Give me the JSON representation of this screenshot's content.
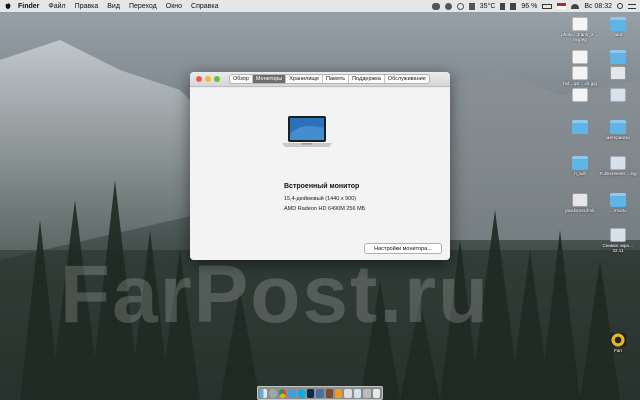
{
  "menubar": {
    "app": "Finder",
    "menus": [
      "Файл",
      "Правка",
      "Вид",
      "Переход",
      "Окно",
      "Справка"
    ],
    "temperature": "35°C",
    "battery": "96 %",
    "clock": "Вс 08:32"
  },
  "window": {
    "tabs": [
      "Обзор",
      "Мониторы",
      "Хранилище",
      "Память",
      "Поддержка",
      "Обслуживание"
    ],
    "active_tab": "Мониторы",
    "display_name": "Встроенный монитор",
    "resolution": "15,4-дюймовый (1440 x 900)",
    "graphics": "AMD Radeon HD 6490M 256 МБ",
    "settings_button": "Настройки монитора..."
  },
  "desktop": {
    "watermark": "FarPost.ru",
    "icons": [
      {
        "label": "photo…3 ans_3 …m.jpeg",
        "kind": "doc"
      },
      {
        "label": "card",
        "kind": "folder"
      },
      {
        "label": "",
        "kind": "doc"
      },
      {
        "label": "",
        "kind": "folder"
      },
      {
        "label": "hid…qsl …ck.jpg",
        "kind": "doc"
      },
      {
        "label": "",
        "kind": "docdark"
      },
      {
        "label": "",
        "kind": "doc"
      },
      {
        "label": "",
        "kind": "shot"
      },
      {
        "label": "",
        "kind": "folder"
      },
      {
        "label": "материалы",
        "kind": "folder"
      },
      {
        "label": "h_wiif",
        "kind": "folder"
      },
      {
        "label": "FullScreenM …ing",
        "kind": "shot"
      },
      {
        "label": "javaforest.ifmb",
        "kind": "docdark"
      },
      {
        "label": "…rmorto",
        "kind": "folder"
      },
      {
        "label": "Снимок экра…32.11",
        "kind": "shot"
      },
      {
        "label": "Fan",
        "kind": "fan"
      }
    ]
  },
  "colors": {
    "close": "#ee5a52",
    "minimize": "#f5bd2f",
    "zoom": "#5fc43e",
    "folder": "#5fb4e6"
  },
  "dock": [
    "finder-icon",
    "launchpad-icon",
    "chrome-icon",
    "safari-icon",
    "skype-icon",
    "photoshop-icon",
    "app-icon",
    "app-icon",
    "illustrator-icon",
    "app-icon",
    "preview-icon",
    "app-icon",
    "trash-icon"
  ]
}
